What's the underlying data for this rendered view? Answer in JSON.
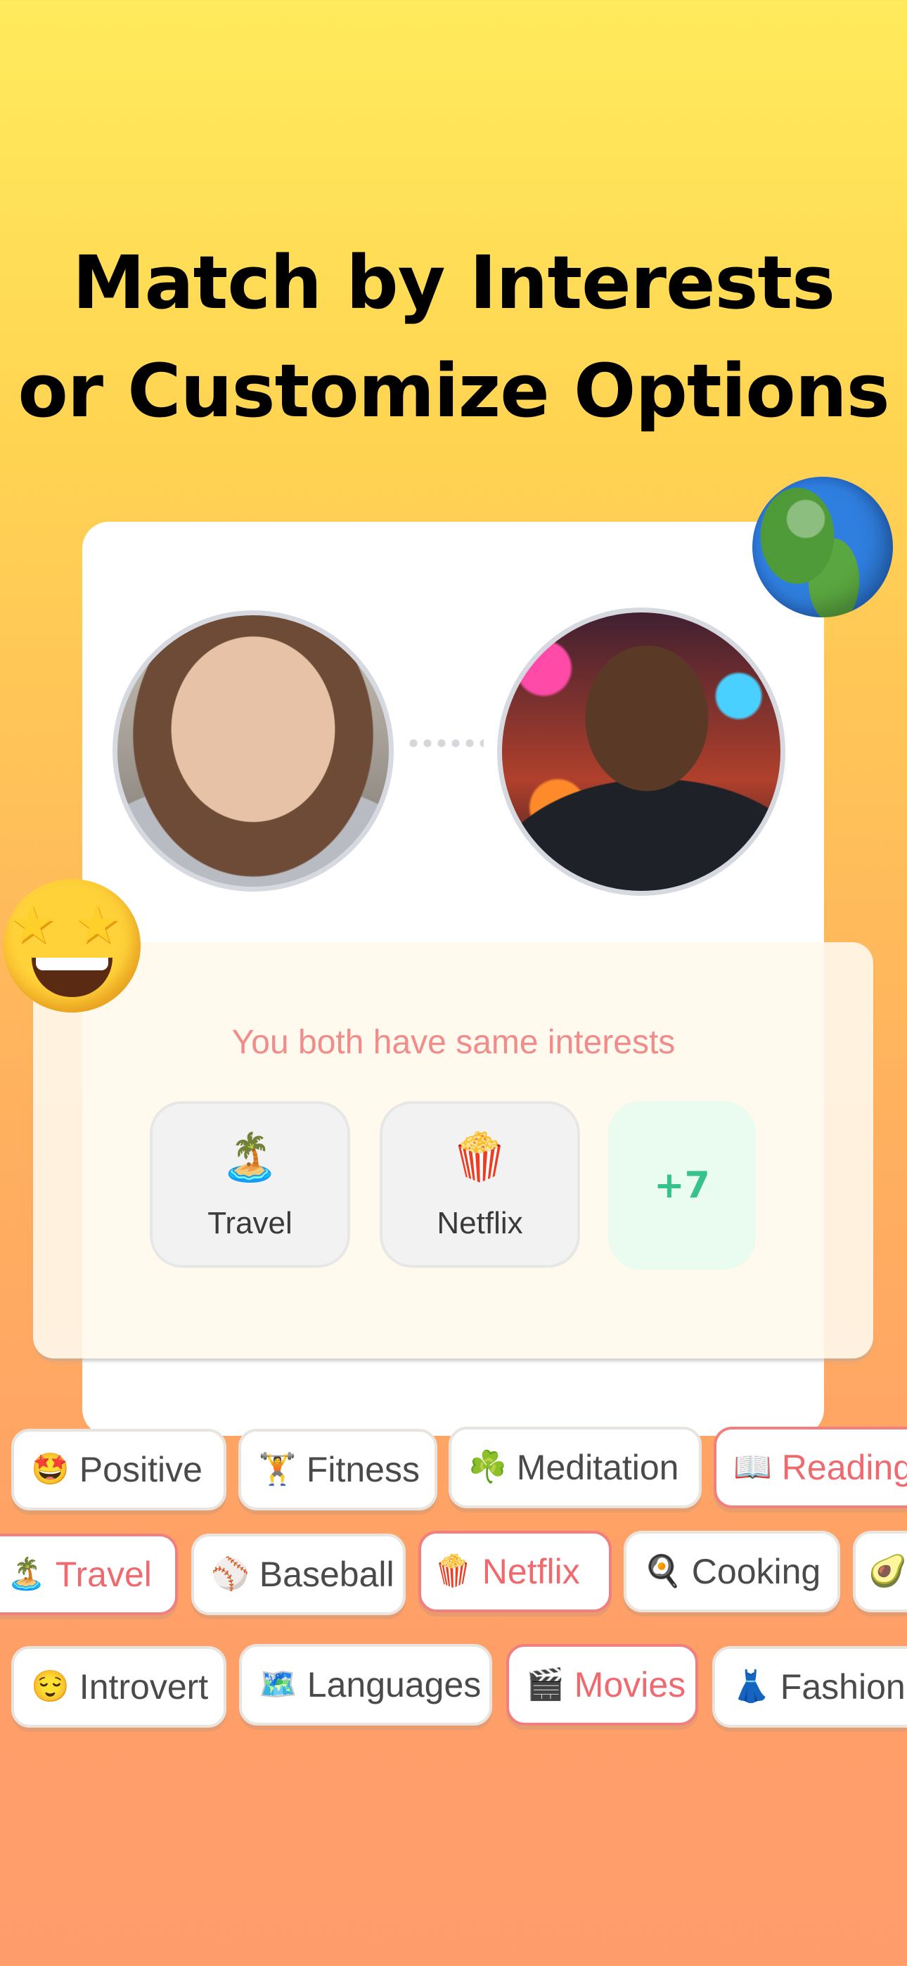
{
  "headline": {
    "line1_regular": "Match by ",
    "line1_bold": "Interests",
    "line2_regular": "or Customize ",
    "line2_bold": "Options"
  },
  "match_card": {
    "interests_title": "You both have same interests",
    "shared": [
      {
        "icon": "🏝️",
        "label": "Travel"
      },
      {
        "icon": "🍿",
        "label": "Netflix"
      }
    ],
    "more": "+7"
  },
  "tags": {
    "row1": [
      {
        "icon": "🤩",
        "label": "Positive",
        "selected": false
      },
      {
        "icon": "🏋️",
        "label": "Fitness",
        "selected": false
      },
      {
        "icon": "☘️",
        "label": "Meditation",
        "selected": false
      },
      {
        "icon": "📖",
        "label": "Reading",
        "selected": true
      }
    ],
    "row2": [
      {
        "icon": "🏝️",
        "label": "Travel",
        "selected": true
      },
      {
        "icon": "⚾",
        "label": "Baseball",
        "selected": false
      },
      {
        "icon": "🍿",
        "label": "Netflix",
        "selected": true
      },
      {
        "icon": "🍳",
        "label": "Cooking",
        "selected": false
      },
      {
        "icon": "🥑",
        "label": "",
        "selected": false
      }
    ],
    "row3": [
      {
        "icon": "😌",
        "label": "Introvert",
        "selected": false
      },
      {
        "icon": "🗺️",
        "label": "Languages",
        "selected": false
      },
      {
        "icon": "🎬",
        "label": "Movies",
        "selected": true
      },
      {
        "icon": "👗",
        "label": "Fashion",
        "selected": false
      }
    ]
  },
  "colors": {
    "background_top": "#FFEB5C",
    "background_bottom": "#FF9C6C",
    "accent_pink": "#EF6A6E",
    "plus_green": "#36C28A"
  }
}
